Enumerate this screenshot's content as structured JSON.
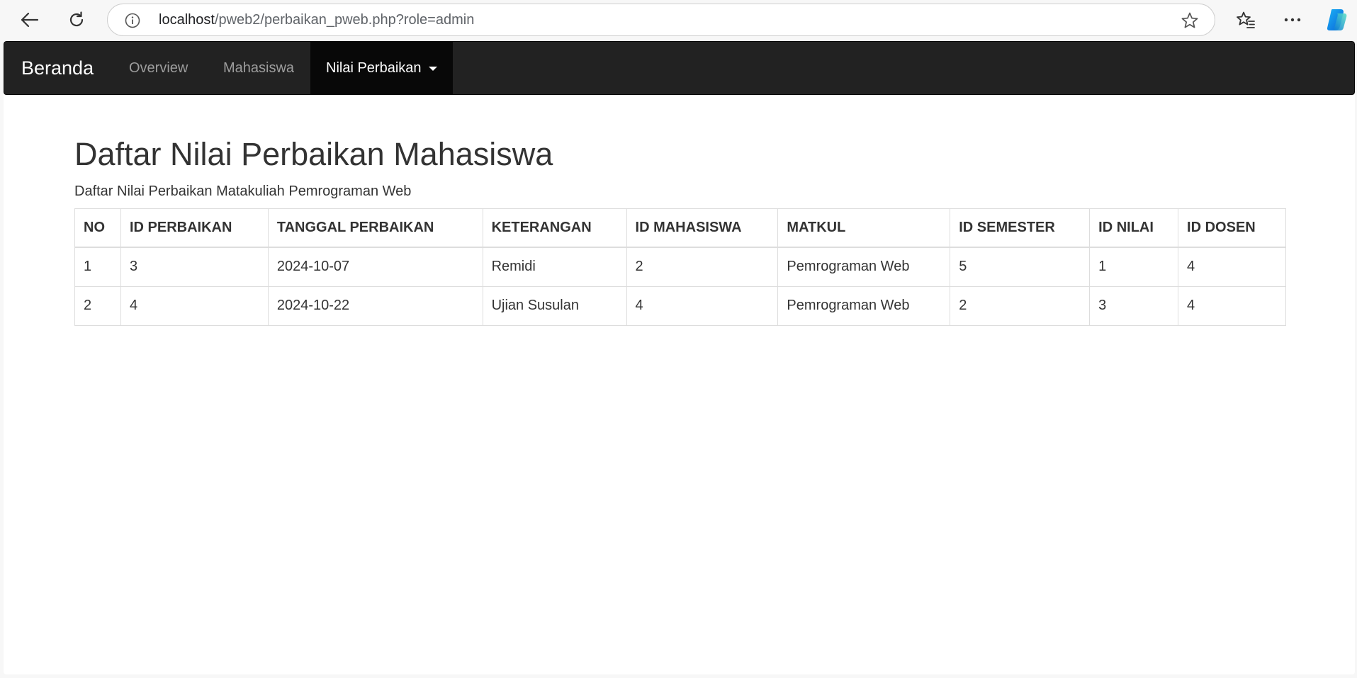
{
  "browser": {
    "url_host": "localhost",
    "url_path": "/pweb2/perbaikan_pweb.php?role=admin"
  },
  "navbar": {
    "brand": "Beranda",
    "links": [
      {
        "label": "Overview"
      },
      {
        "label": "Mahasiswa"
      },
      {
        "label": "Nilai Perbaikan"
      }
    ]
  },
  "main": {
    "title": "Daftar Nilai Perbaikan Mahasiswa",
    "subtitle": "Daftar Nilai Perbaikan Matakuliah Pemrograman Web",
    "table": {
      "headers": [
        "NO",
        "ID PERBAIKAN",
        "TANGGAL PERBAIKAN",
        "KETERANGAN",
        "ID MAHASISWA",
        "MATKUL",
        "ID SEMESTER",
        "ID NILAI",
        "ID DOSEN"
      ],
      "rows": [
        [
          "1",
          "3",
          "2024-10-07",
          "Remidi",
          "2",
          "Pemrograman Web",
          "5",
          "1",
          "4"
        ],
        [
          "2",
          "4",
          "2024-10-22",
          "Ujian Susulan",
          "4",
          "Pemrograman Web",
          "2",
          "3",
          "4"
        ]
      ]
    }
  },
  "icons": {
    "back": "back-arrow-icon",
    "reload": "reload-icon",
    "info": "info-icon",
    "star": "star-icon",
    "favorites": "favorites-icon",
    "more": "more-icon",
    "copilot": "copilot-icon"
  },
  "colors": {
    "navbar_bg": "#222222",
    "navbar_active_bg": "#080808",
    "nav_link": "#9d9d9d",
    "text": "#333333",
    "table_border": "#dddddd"
  }
}
